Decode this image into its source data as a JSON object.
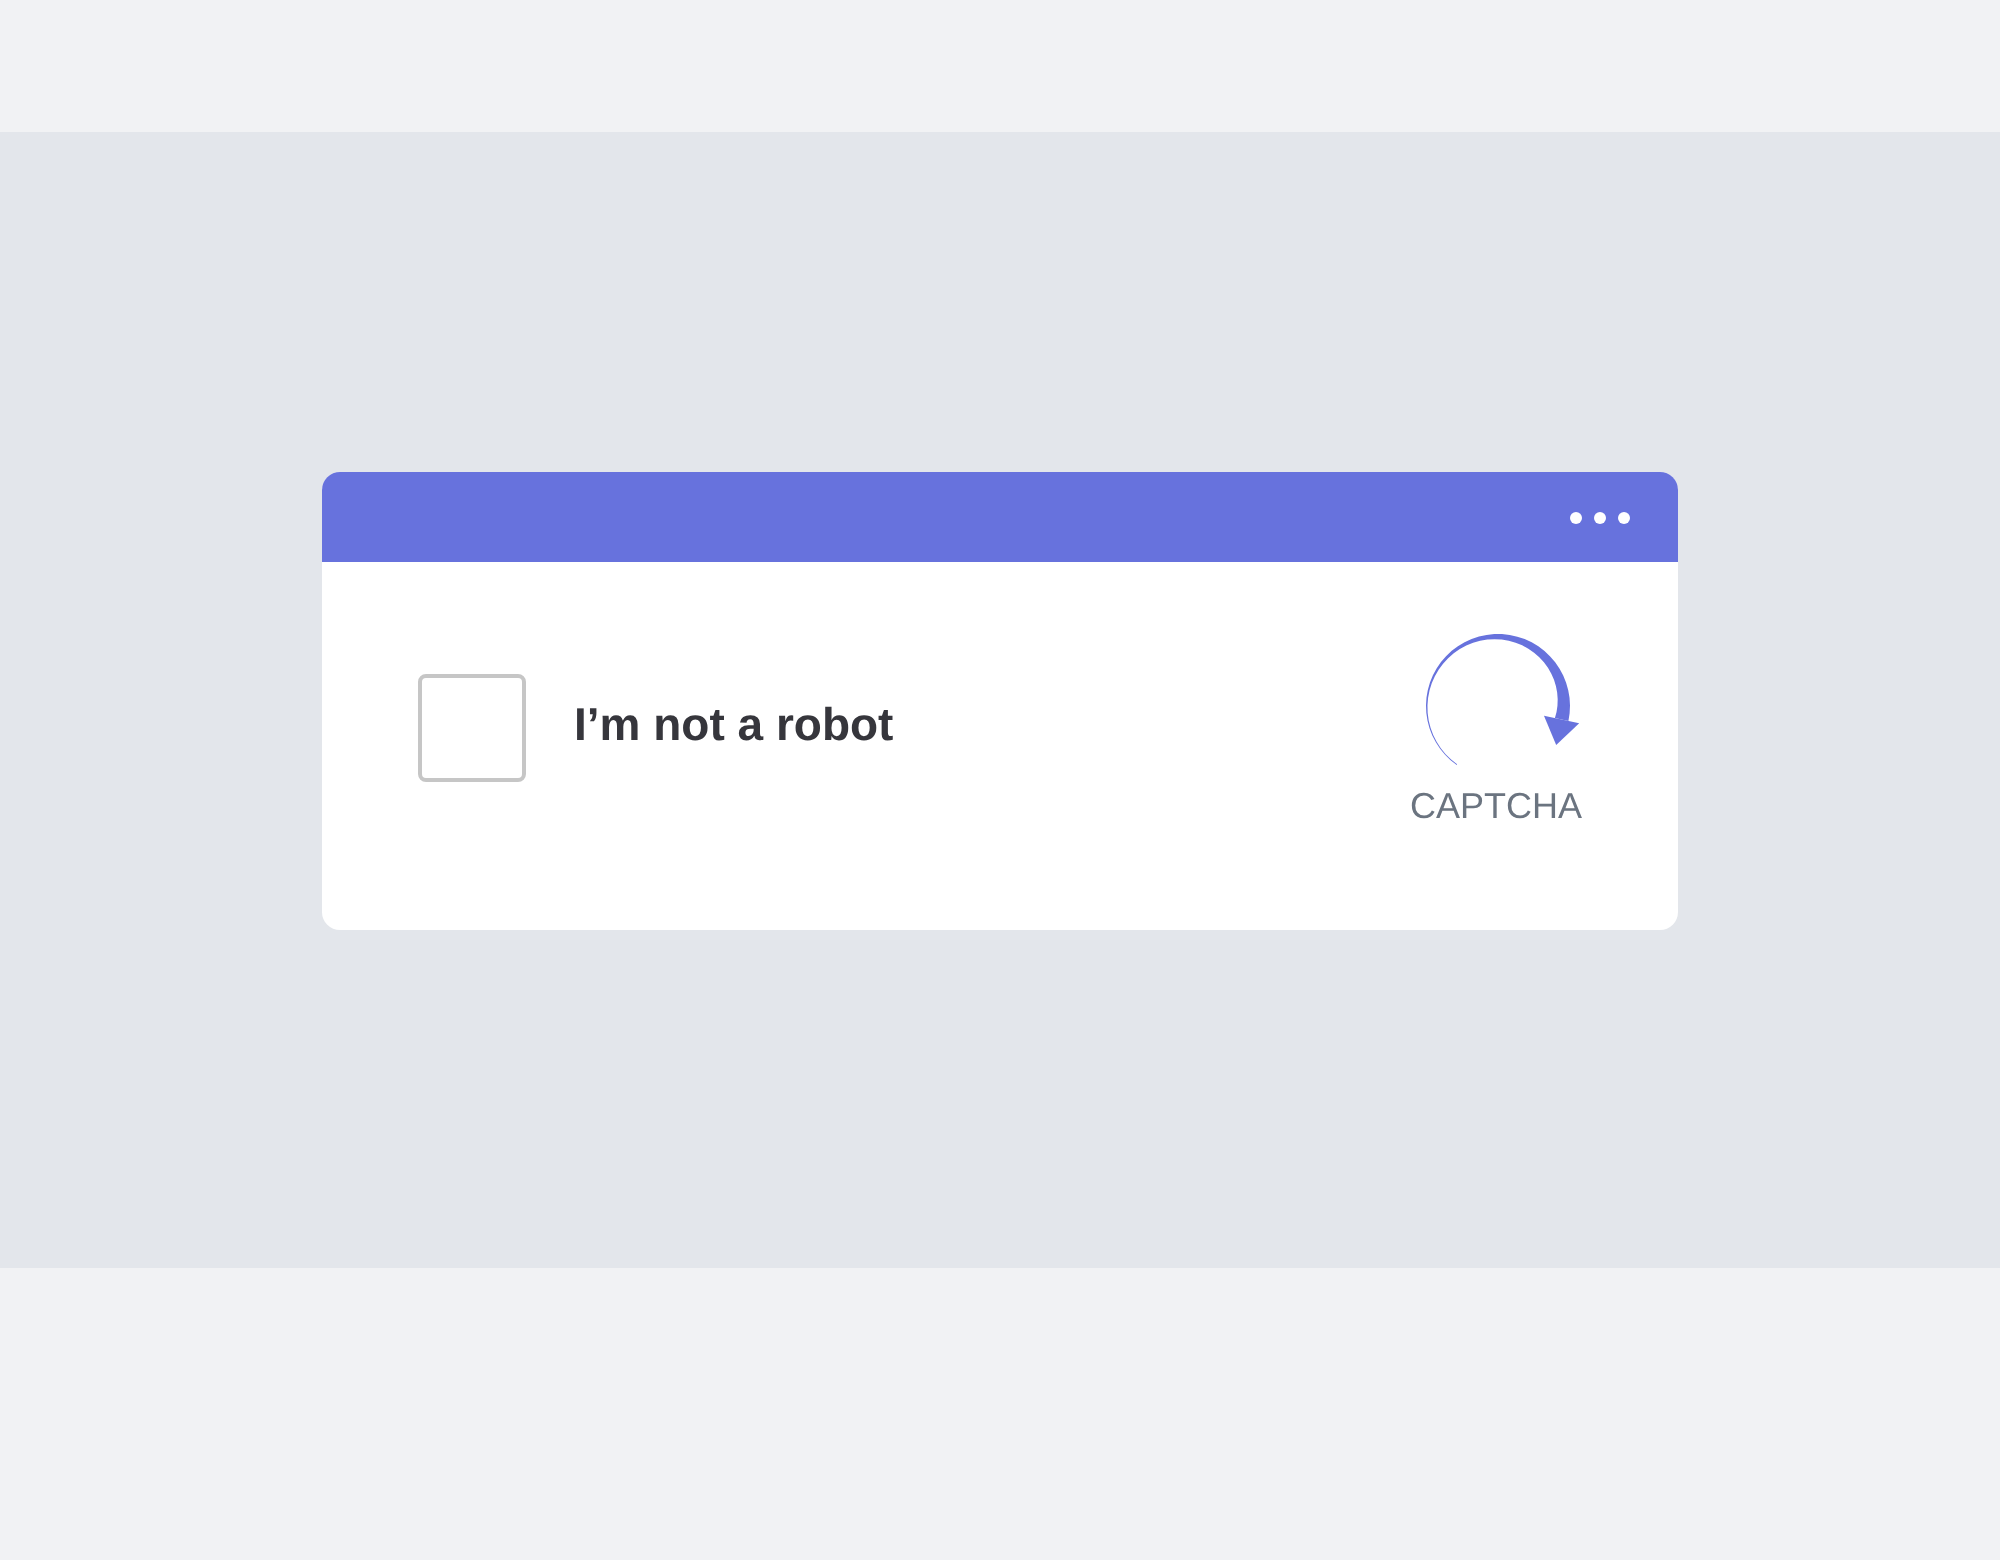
{
  "checkbox": {
    "label": "I’m not a robot",
    "checked": false
  },
  "logo": {
    "text": "CAPTCHA"
  }
}
